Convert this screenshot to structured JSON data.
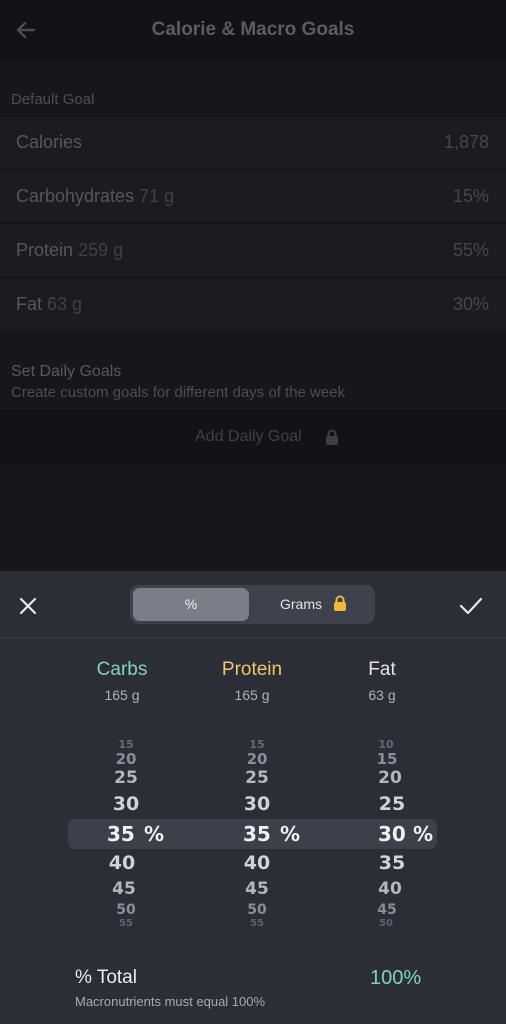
{
  "page": {
    "title": "Calorie & Macro Goals",
    "default_goal_label": "Default Goal",
    "rows": [
      {
        "label": "Calories",
        "sub": "",
        "value": "1,878"
      },
      {
        "label": "Carbohydrates",
        "sub": "71 g",
        "value": "15%"
      },
      {
        "label": "Protein",
        "sub": "259 g",
        "value": "55%"
      },
      {
        "label": "Fat",
        "sub": "63 g",
        "value": "30%"
      }
    ],
    "daily_goals_title": "Set Daily Goals",
    "daily_goals_sub": "Create custom goals for different days of the week",
    "add_daily_goal": "Add Daily Goal"
  },
  "sheet": {
    "seg_percent": "%",
    "seg_grams": "Grams",
    "columns": [
      {
        "name": "Carbs",
        "grams": "165 g",
        "color": "#84d4b6",
        "above": [
          "15",
          "20",
          "25",
          "30"
        ],
        "selected": "35",
        "below": [
          "40",
          "45",
          "50",
          "55"
        ]
      },
      {
        "name": "Protein",
        "grams": "165 g",
        "color": "#f2c46b",
        "above": [
          "15",
          "20",
          "25",
          "30"
        ],
        "selected": "35",
        "below": [
          "40",
          "45",
          "50",
          "55"
        ]
      },
      {
        "name": "Fat",
        "grams": "63 g",
        "color": "#e4e4e7",
        "above": [
          "10",
          "15",
          "20",
          "25"
        ],
        "selected": "30",
        "below": [
          "35",
          "40",
          "45",
          "50"
        ]
      }
    ],
    "unit": "%",
    "total_label": "% Total",
    "total_value": "100%",
    "total_note": "Macronutrients must equal 100%"
  }
}
